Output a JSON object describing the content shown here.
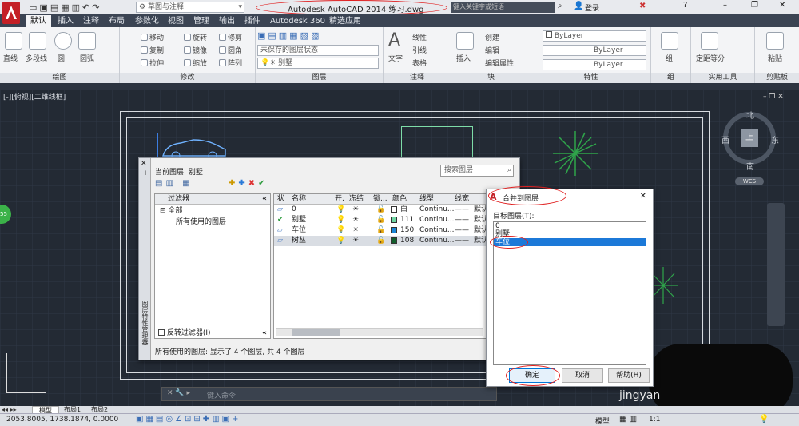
{
  "titlebar": {
    "workspace": "草图与注释",
    "title": "Autodesk AutoCAD 2014    练习.dwg",
    "search_placeholder": "键入关键字或短语",
    "login": "登录"
  },
  "ribbon_tabs": [
    "默认",
    "插入",
    "注释",
    "布局",
    "参数化",
    "视图",
    "管理",
    "输出",
    "插件",
    "Autodesk 360",
    "精选应用"
  ],
  "panels": {
    "draw": {
      "name": "绘图",
      "items": [
        "直线",
        "多段线",
        "圆",
        "圆弧"
      ]
    },
    "modify": {
      "name": "修改",
      "items": [
        "移动",
        "旋转",
        "修剪",
        "复制",
        "镜像",
        "圆角",
        "拉伸",
        "缩放",
        "阵列"
      ]
    },
    "layers": {
      "name": "图层",
      "state_combo": "未保存的图层状态",
      "layer_combo": "别墅"
    },
    "annotation": {
      "name": "注释",
      "items": [
        "文字",
        "线性",
        "引线",
        "表格"
      ]
    },
    "block": {
      "name": "块",
      "items": [
        "插入",
        "创建",
        "编辑",
        "编辑属性"
      ]
    },
    "properties": {
      "name": "特性",
      "items": [
        "ByLayer",
        "ByLayer",
        "ByLayer"
      ]
    },
    "groups": {
      "name": "组",
      "items": [
        "组"
      ]
    },
    "utilities": {
      "name": "实用工具",
      "items": [
        "测量",
        "定距等分"
      ]
    },
    "clipboard": {
      "name": "剪贴板",
      "items": [
        "粘贴"
      ]
    }
  },
  "viewport": {
    "label": "[-][俯视][二维线框]",
    "compass": {
      "n": "北",
      "s": "南",
      "e": "东",
      "w": "西",
      "center": "上"
    },
    "wcs": "WCS"
  },
  "layer_manager": {
    "current_layer": "当前图层: 别墅",
    "search_placeholder": "搜索图层",
    "filters_header": "过滤器",
    "filter_tree": [
      "全部",
      "所有使用的图层"
    ],
    "invert_filter": "反转过滤器(I)",
    "columns": [
      "状",
      "名称",
      "开.",
      "冻结",
      "锁...",
      "颜色",
      "线型",
      "线宽"
    ],
    "rows": [
      {
        "status": "",
        "name": "0",
        "color_name": "白",
        "color_hex": "#ffffff",
        "linetype": "Continu...",
        "lineweight": "默认"
      },
      {
        "status": "✔",
        "name": "别墅",
        "color_name": "111",
        "color_hex": "#6fd6a3",
        "linetype": "Continu...",
        "lineweight": "默认"
      },
      {
        "status": "",
        "name": "车位",
        "color_name": "150",
        "color_hex": "#1a86d6",
        "linetype": "Continu...",
        "lineweight": "默认"
      },
      {
        "status": "",
        "name": "树丛",
        "color_name": "108",
        "color_hex": "#105e2c",
        "linetype": "Continu...",
        "lineweight": "默认"
      }
    ],
    "footer": "所有使用的图层: 显示了 4 个图层, 共 4 个图层",
    "side_title": "图层特性管理器"
  },
  "merge_dialog": {
    "title": "合并到图层",
    "target_label": "目标图层(T):",
    "layers": [
      "0",
      "别墅",
      "车位"
    ],
    "selected": "车位",
    "ok": "确定",
    "cancel": "取消",
    "help": "帮助(H)"
  },
  "command": {
    "placeholder": "键入命令"
  },
  "layout_tabs": [
    "模型",
    "布局1",
    "布局2"
  ],
  "status": {
    "coords": "2053.8005, 1738.1874, 0.0000",
    "model": "模型",
    "scale": "1:1"
  },
  "watermark": "jingyan"
}
